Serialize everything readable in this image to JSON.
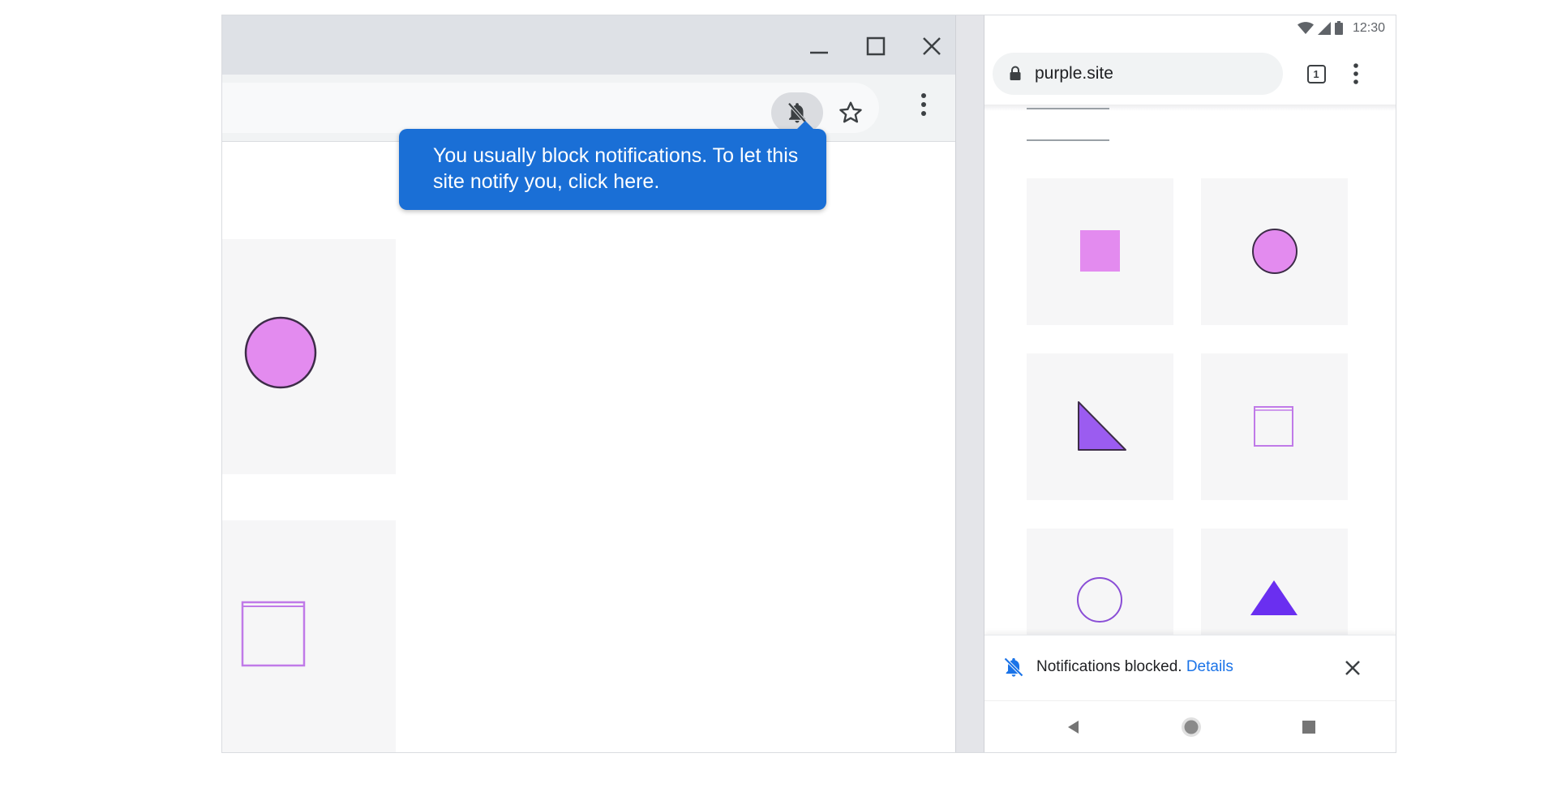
{
  "desktop": {
    "window_controls": {
      "minimize": "minimize",
      "maximize": "maximize",
      "close": "close"
    },
    "toolbar": {
      "notification_icon": "bell-off-icon",
      "bookmark_icon": "star-icon",
      "menu_icon": "more-vert-icon"
    },
    "bubble": {
      "text": "You usually block notifications. To let this site notify you, click here."
    },
    "colors": {
      "bubble_bg": "#1a6fd6",
      "shape_fill": "#e38bef",
      "shape_stroke": "#3d2c48"
    }
  },
  "phone": {
    "status": {
      "time": "12:30",
      "icons": [
        "wifi-icon",
        "signal-icon",
        "battery-icon"
      ]
    },
    "url": "purple.site",
    "tab_count": "1",
    "infobar": {
      "message": "Notifications blocked.",
      "link": "Details"
    },
    "nav": [
      "back-icon",
      "home-icon",
      "recents-icon"
    ],
    "colors": {
      "pink": "#e38bef",
      "violet": "#9b5cf0",
      "indigo": "#6a2ff0",
      "link": "#1a73e8"
    }
  }
}
